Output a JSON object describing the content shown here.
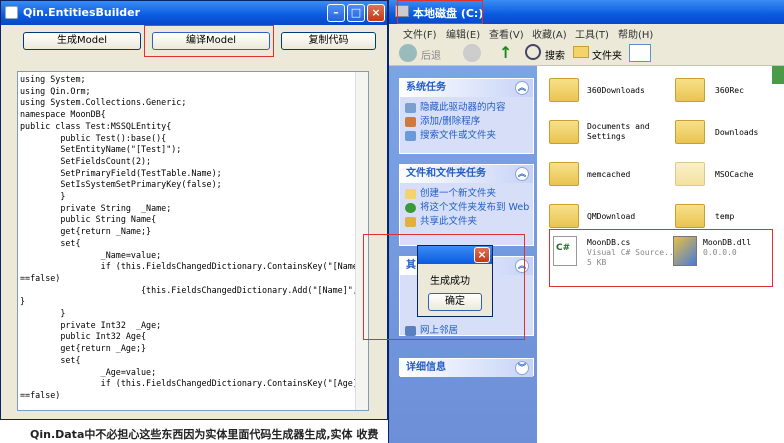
{
  "builder": {
    "title": "Qin.EntitiesBuilder",
    "buttons": [
      "生成Model",
      "编译Model",
      "复制代码"
    ],
    "code_lines": [
      "using System;",
      "using Qin.Orm;",
      "using System.Collections.Generic;",
      "namespace MoonDB{",
      "public class Test:MSSQLEntity{",
      "        public Test():base(){",
      "        SetEntityName(\"[Test]\");",
      "        SetFieldsCount(2);",
      "        SetPrimaryField(TestTable.Name);",
      "        SetIsSystemSetPrimaryKey(false);",
      "        }",
      "        private String  _Name;",
      "        public String Name{",
      "        get{return _Name;}",
      "        set{",
      "                _Name=value;",
      "                if (this.FieldsChangedDictionary.ContainsKey(\"[Name]\")",
      "==false)",
      "                        {this.FieldsChangedDictionary.Add(\"[Name]\",value);}",
      "",
      "}",
      "        }",
      "        private Int32  _Age;",
      "        public Int32 Age{",
      "        get{return _Age;}",
      "        set{",
      "                _Age=value;",
      "                if (this.FieldsChangedDictionary.ContainsKey(\"[Age]\")",
      "==false)"
    ]
  },
  "bottom_caption": "Qin.Data中不必担心这些东西因为实体里面代码生成器生成,实体  收费",
  "explorer": {
    "title": "本地磁盘 (C:)",
    "menu": [
      "文件(F)",
      "编辑(E)",
      "查看(V)",
      "收藏(A)",
      "工具(T)",
      "帮助(H)"
    ],
    "toolbar": {
      "back": "后退",
      "search": "搜索",
      "folders": "文件夹"
    },
    "panels": {
      "system_tasks": {
        "title": "系统任务",
        "links": [
          "隐藏此驱动器的内容",
          "添加/删除程序",
          "搜索文件或文件夹"
        ]
      },
      "file_tasks": {
        "title": "文件和文件夹任务",
        "links": [
          "创建一个新文件夹",
          "将这个文件夹发布到 Web",
          "共享此文件夹"
        ]
      },
      "other_places": {
        "title": "其",
        "links": [
          "网上邻居"
        ]
      },
      "details": {
        "title": "详细信息"
      }
    },
    "folders": [
      "360Downloads",
      "360Rec",
      "Documents and Settings",
      "Downloads",
      "memcached",
      "MSOCache",
      "QMDownload",
      "temp"
    ],
    "files": [
      {
        "name": "MoonDB.cs",
        "type": "Visual C# Source...",
        "size": "5 KB"
      },
      {
        "name": "MoonDB.dll",
        "version": "0.0.0.0"
      }
    ]
  },
  "dialog": {
    "message": "生成成功",
    "ok": "确定"
  }
}
